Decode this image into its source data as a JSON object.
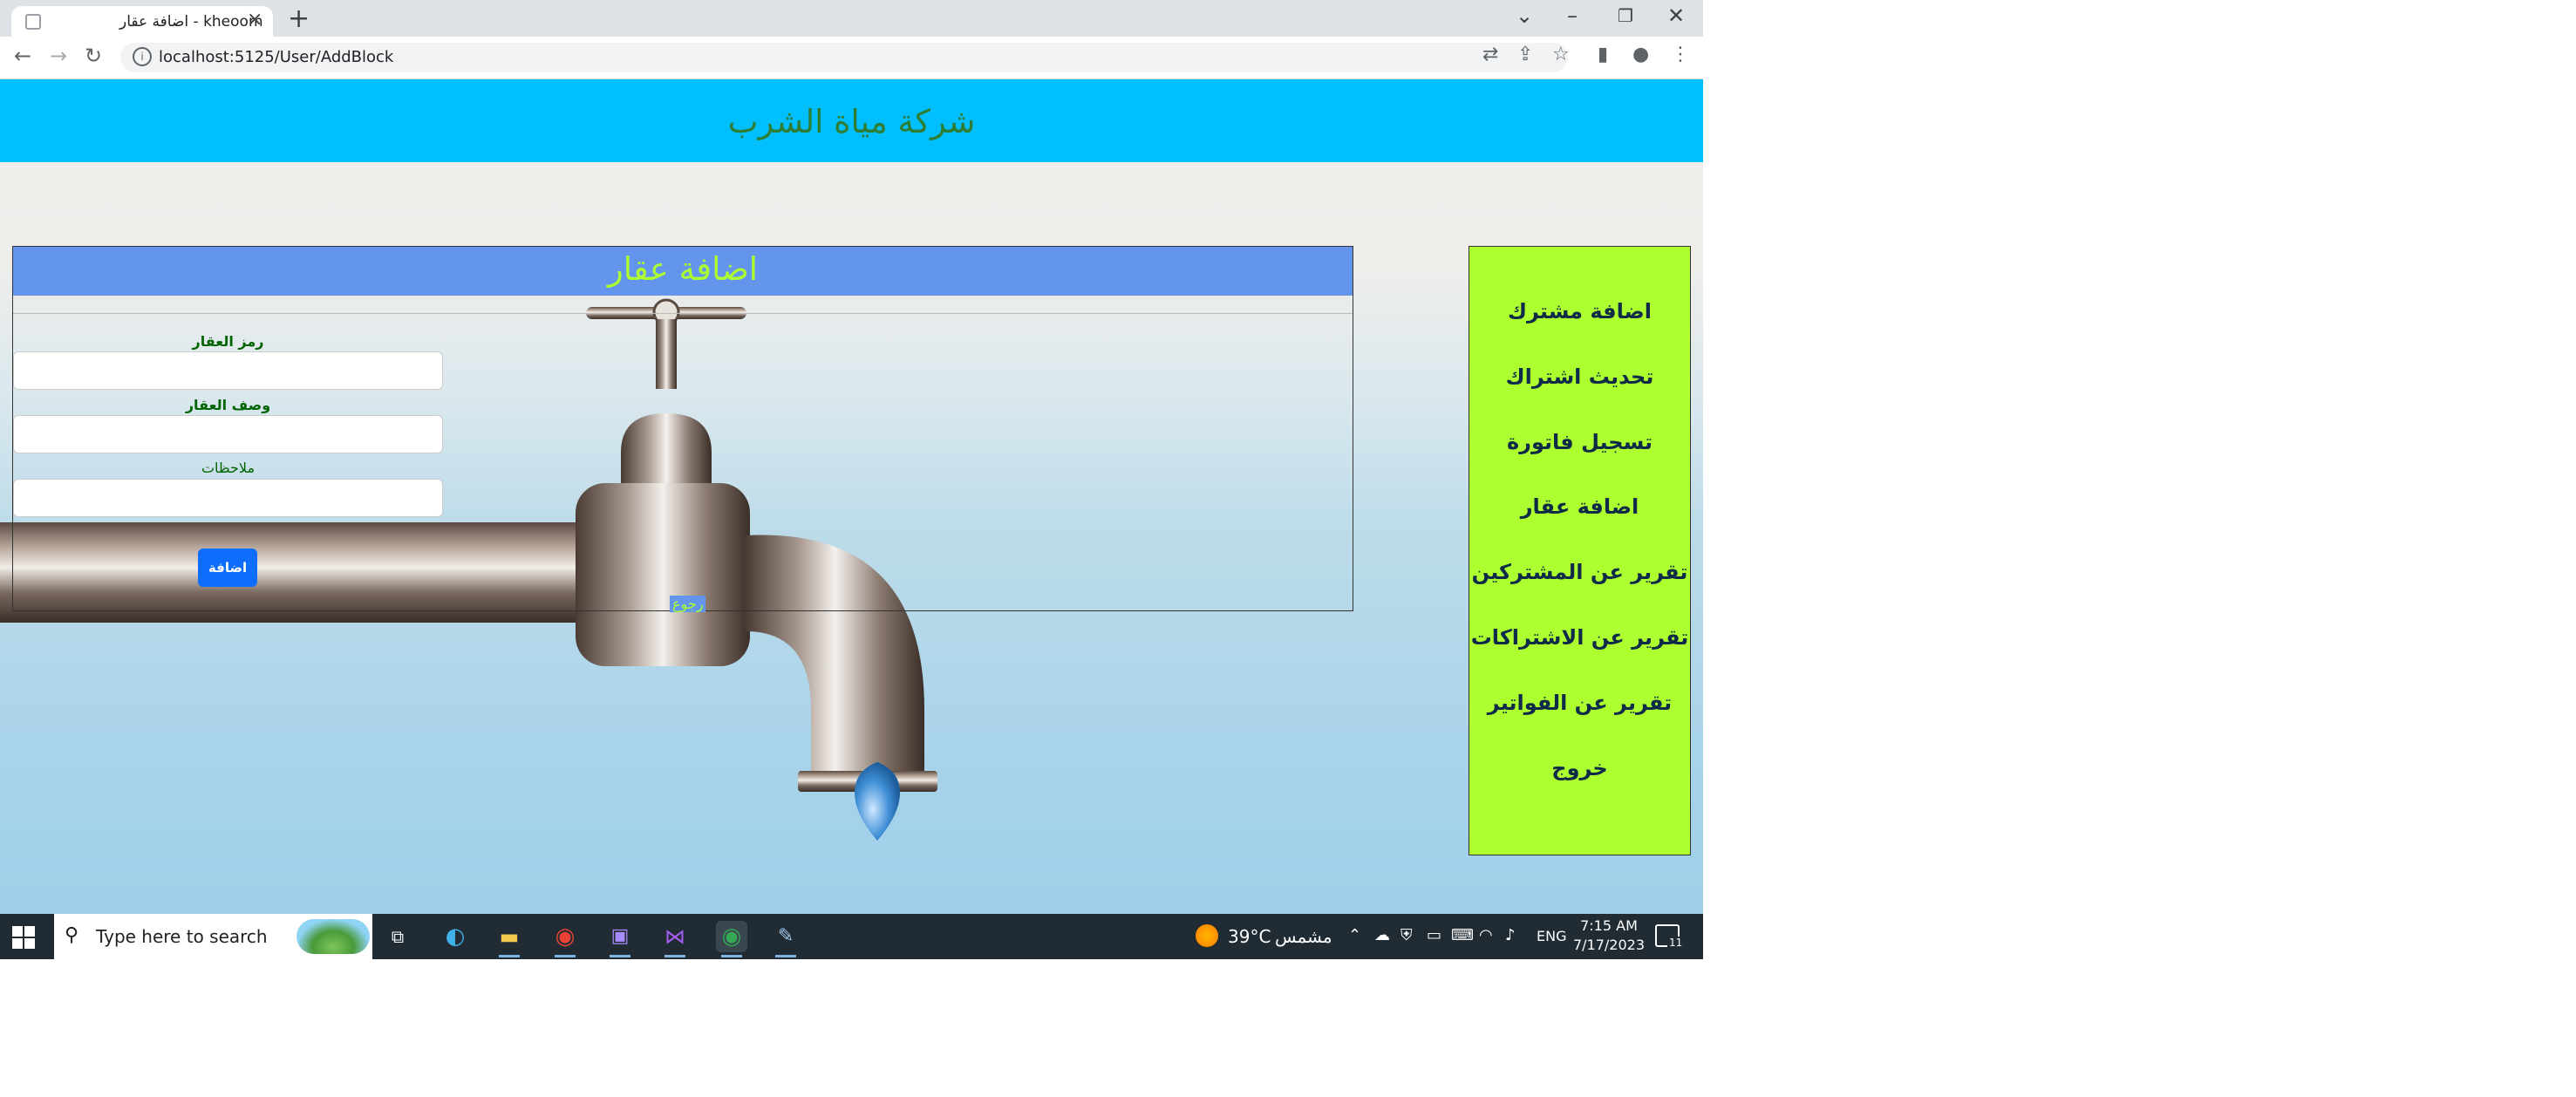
{
  "browser": {
    "tab_title": "اضافة عقار - kheoom",
    "url": "localhost:5125/User/AddBlock"
  },
  "site": {
    "title": "شركة مياة الشرب"
  },
  "form": {
    "heading": "اضافة عقار",
    "fields": [
      {
        "label": "رمز العقار",
        "value": "",
        "placeholder": ""
      },
      {
        "label": "وصف العقار",
        "value": "",
        "placeholder": ""
      },
      {
        "label": "ملاحظات",
        "value": "",
        "placeholder": ""
      }
    ],
    "submit_label": "اضافة",
    "back_label": "رجوع"
  },
  "menu": {
    "items": [
      {
        "label": "اضافة مشترك"
      },
      {
        "label": "تحديث اشتراك"
      },
      {
        "label": "تسجيل فاتورة"
      },
      {
        "label": "اضافة عقار"
      },
      {
        "label": "تقرير عن المشتركين"
      },
      {
        "label": "تقرير عن الاشتراكات"
      },
      {
        "label": "تقرير عن الفواتير"
      },
      {
        "label": "خروج"
      }
    ]
  },
  "taskbar": {
    "search_placeholder": "Type here to search",
    "weather_temp": "39°C",
    "weather_desc": "مشمس",
    "language": "ENG",
    "time": "7:15 AM",
    "date": "7/17/2023",
    "notifications_count": "11"
  },
  "colors": {
    "header_bg": "#00bfff",
    "site_title": "#2e7d32",
    "form_heading_bg": "#6495ed",
    "form_heading_text": "#adff2f",
    "label_text": "#006400",
    "submit_bg": "#0d6efd",
    "menu_bg": "#adff2f",
    "menu_text": "#0f2b48"
  }
}
